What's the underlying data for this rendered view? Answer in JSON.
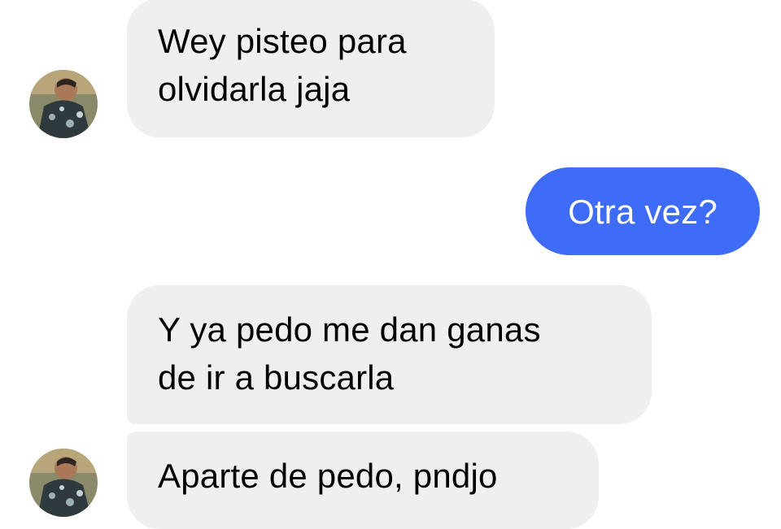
{
  "conversation": {
    "messages": [
      {
        "sender": "contact",
        "lines": [
          "Wey pisteo para",
          "olvidarla jaja"
        ]
      },
      {
        "sender": "me",
        "lines": [
          "Otra vez?"
        ]
      },
      {
        "sender": "contact",
        "lines": [
          "Y ya pedo me dan ganas",
          "de ir a buscarla"
        ]
      },
      {
        "sender": "contact",
        "lines": [
          "Aparte de pedo, pndjo"
        ]
      }
    ]
  },
  "colors": {
    "incoming_bubble": "#efefef",
    "outgoing_bubble": "#3e6cf6",
    "incoming_text": "#000000",
    "outgoing_text": "#ffffff"
  },
  "icons": {
    "avatar": "contact-avatar"
  }
}
